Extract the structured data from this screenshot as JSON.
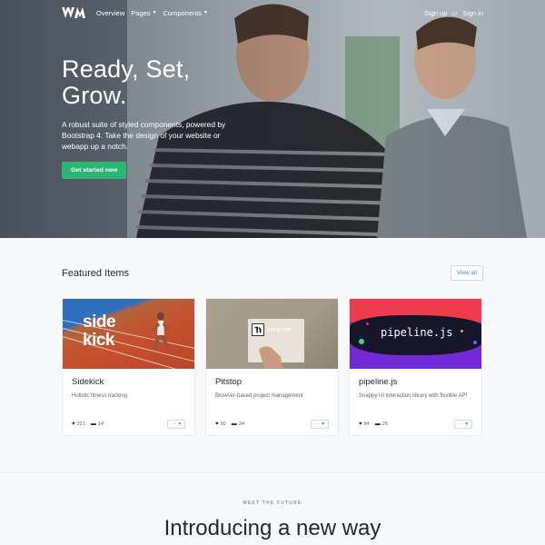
{
  "nav": {
    "logo_icon": "wm-logo-icon",
    "links": [
      {
        "label": "Overview",
        "dropdown": false
      },
      {
        "label": "Pages",
        "dropdown": true
      },
      {
        "label": "Components",
        "dropdown": true
      }
    ],
    "signup_label": "Sign up",
    "or_label": "or",
    "signin_label": "Sign in"
  },
  "hero": {
    "title": "Ready, Set, Grow.",
    "lead": "A robust suite of styled components, powered by Bootstrap 4. Take the design of your website or webapp up a notch.",
    "cta_label": "Get started now",
    "cta_color": "#2bb673"
  },
  "featured": {
    "title": "Featured Items",
    "view_all_label": "View all",
    "cards": [
      {
        "image_text": "side kick",
        "title": "Sidekick",
        "description": "Holistic fitness tracking",
        "likes": "221",
        "comments": "14",
        "more_label": "··· ▾"
      },
      {
        "image_text": "PITSTOP",
        "title": "Pitstop",
        "description": "Browser-based project management",
        "likes": "90",
        "comments": "34",
        "more_label": "··· ▾"
      },
      {
        "image_text": "pipeline.js",
        "title": "pipeline.js",
        "description": "Snappy UI interaction library with flexible API",
        "likes": "84",
        "comments": "25",
        "more_label": "··· ▾"
      }
    ]
  },
  "intro": {
    "eyebrow": "MEET THE FUTURE",
    "title": "Introducing a new way"
  },
  "colors": {
    "accent": "#3d7ee0",
    "success": "#2bb673",
    "pipeline_red": "#ef3b4e",
    "pipeline_purple": "#7229d6"
  }
}
